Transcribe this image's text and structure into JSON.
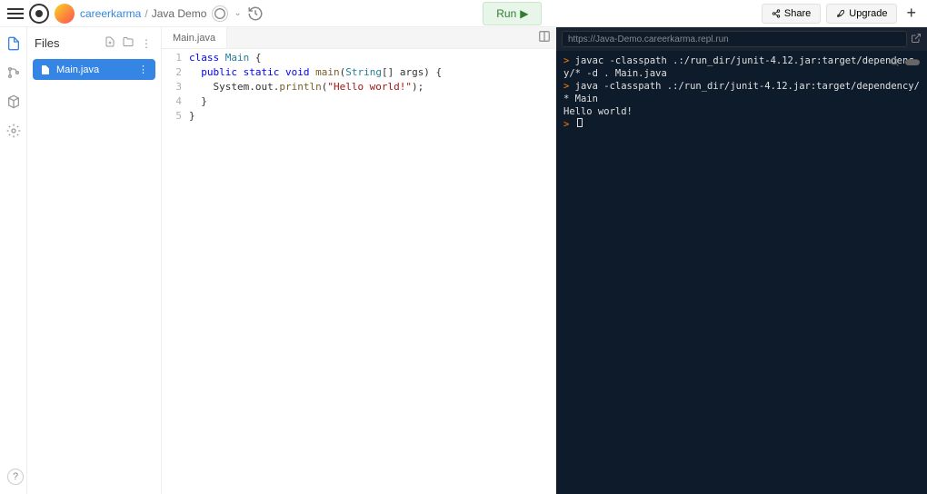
{
  "header": {
    "user": "careerkarma",
    "separator": "/",
    "project": "Java Demo",
    "run_label": "Run",
    "share_label": "Share",
    "upgrade_label": "Upgrade"
  },
  "sidebar": {
    "title": "Files",
    "files": [
      {
        "name": "Main.java"
      }
    ]
  },
  "editor": {
    "tab_label": "Main.java",
    "lines": [
      {
        "n": "1",
        "tokens": [
          {
            "t": "class ",
            "c": "kw"
          },
          {
            "t": "Main",
            "c": "type"
          },
          {
            "t": " {",
            "c": ""
          }
        ]
      },
      {
        "n": "2",
        "tokens": [
          {
            "t": "  public static void ",
            "c": "kw"
          },
          {
            "t": "main",
            "c": "method"
          },
          {
            "t": "(",
            "c": ""
          },
          {
            "t": "String",
            "c": "type"
          },
          {
            "t": "[] args) {",
            "c": ""
          }
        ]
      },
      {
        "n": "3",
        "tokens": [
          {
            "t": "    System.out.",
            "c": ""
          },
          {
            "t": "println",
            "c": "method"
          },
          {
            "t": "(",
            "c": ""
          },
          {
            "t": "\"Hello world!\"",
            "c": "str"
          },
          {
            "t": ");",
            "c": ""
          }
        ]
      },
      {
        "n": "4",
        "tokens": [
          {
            "t": "  }",
            "c": ""
          }
        ]
      },
      {
        "n": "5",
        "tokens": [
          {
            "t": "}",
            "c": ""
          }
        ]
      }
    ]
  },
  "console": {
    "url": "https://Java-Demo.careerkarma.repl.run",
    "lines": [
      {
        "prompt": true,
        "text": "javac -classpath .:/run_dir/junit-4.12.jar:target/dependency/* -d . Main.java"
      },
      {
        "prompt": true,
        "text": "java -classpath .:/run_dir/junit-4.12.jar:target/dependency/* Main"
      },
      {
        "prompt": false,
        "text": "Hello world!"
      }
    ]
  },
  "help_label": "?"
}
